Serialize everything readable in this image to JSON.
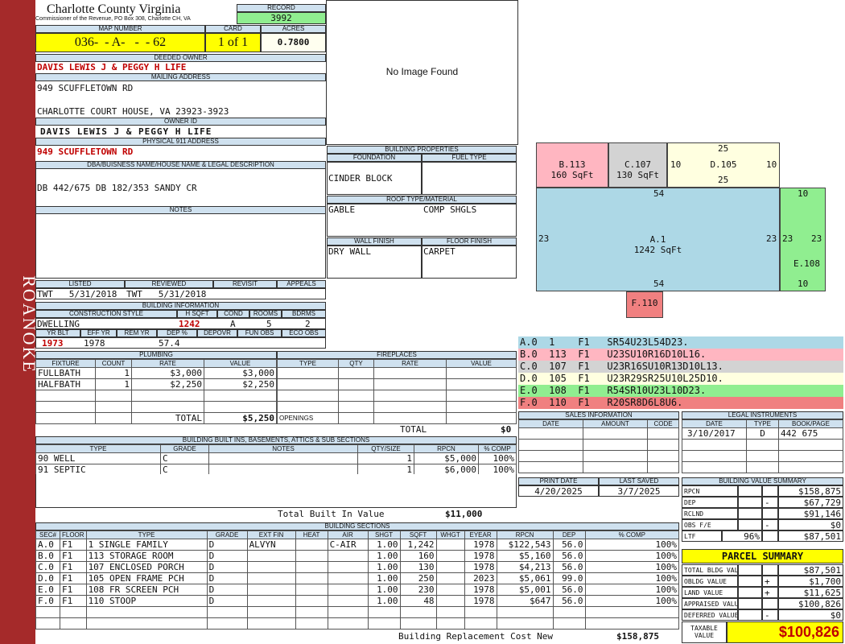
{
  "sidebar_label": "ROANOKE",
  "county": "Charlotte County Virginia",
  "commissioner": "Commissioner of the Revenue, PO Box 308, Charlotte CH, VA",
  "labels": {
    "record": "RECORD",
    "map_number": "MAP NUMBER",
    "card": "CARD",
    "acres": "ACRES",
    "deeded_owner": "DEEDED OWNER",
    "mailing_address": "MAILING ADDRESS",
    "owner_id": "OWNER ID",
    "physical_address": "PHYSICAL 911 ADDRESS",
    "dba": "DBA/BUISNESS NAME/HOUSE NAME & LEGAL DESCRIPTION",
    "notes": "NOTES",
    "listed": "LISTED",
    "reviewed": "REVIEWED",
    "revisit": "REVISIT",
    "appeals": "APPEALS",
    "building_information": "BUILDING INFORMATION",
    "construction_style": "CONSTRUCTION STYLE",
    "h_sqft": "H SQFT",
    "cond": "COND",
    "rooms": "ROOMS",
    "bdrms": "BDRMS",
    "yr_blt": "YR BLT",
    "eff_yr": "EFF YR",
    "rem_yr": "REM YR",
    "dep_pct": "DEP %",
    "depovr": "DEPOVR",
    "fun_obs": "FUN OBS",
    "eco_obs": "ECO OBS",
    "building_properties": "BUILDING PROPERTIES",
    "foundation": "FOUNDATION",
    "fuel_type": "FUEL TYPE",
    "roof": "ROOF TYPE/MATERIAL",
    "wall_finish": "WALL FINISH",
    "floor_finish": "FLOOR FINISH",
    "plumbing": "PLUMBING",
    "fireplaces": "FIREPLACES",
    "built_ins": "BUILDING BUILT INS, BASEMENTS, ATTICS & SUB SECTIONS",
    "building_sections": "BUILDING SECTIONS",
    "sales_information": "SALES INFORMATION",
    "legal_instruments": "LEGAL INSTRUMENTS",
    "print_date": "PRINT DATE",
    "last_saved": "LAST SAVED",
    "value_summary": "BUILDING VALUE SUMMARY",
    "parcel_summary": "PARCEL SUMMARY",
    "openings": "OPENINGS",
    "total": "TOTAL"
  },
  "record": "3992",
  "map_number": "036-  - A-   -  - 62",
  "card": "1 of 1",
  "acres": "0.7800",
  "deeded_owner": "DAVIS LEWIS J & PEGGY H LIFE",
  "mailing_line1": "949 SCUFFLETOWN RD",
  "mailing_line2": "CHARLOTTE COURT HOUSE, VA 23923-3923",
  "owner_id": "DAVIS LEWIS J & PEGGY H LIFE",
  "physical_address": "949 SCUFFLETOWN RD",
  "legal_description": "DB 442/675 DB 182/353 SANDY CR",
  "image_placeholder": "No Image Found",
  "listed": "TWT   5/31/2018",
  "reviewed": "TWT   5/31/2018",
  "building_info": {
    "style": "DWELLING",
    "hsqft": "1242",
    "cond": "A",
    "rooms": "5",
    "bdrms": "2",
    "yr_blt": "1973",
    "eff_yr": "1978",
    "rem_yr": "",
    "dep": "57.4"
  },
  "properties": {
    "foundation": "CINDER BLOCK",
    "fuel": "",
    "roof1": "GABLE",
    "roof2": "COMP SHGLS",
    "wall": "DRY WALL",
    "floor": "CARPET"
  },
  "plumbing": {
    "headers": [
      "FIXTURE",
      "COUNT",
      "RATE",
      "VALUE"
    ],
    "rows": [
      [
        "FULLBATH",
        "1",
        "$3,000",
        "$3,000"
      ],
      [
        "HALFBATH",
        "1",
        "$2,250",
        "$2,250"
      ]
    ],
    "total": "$5,250"
  },
  "fireplaces": {
    "headers": [
      "TYPE",
      "QTY",
      "RATE",
      "VALUE"
    ],
    "total": "$0"
  },
  "built_ins": {
    "headers": [
      "TYPE",
      "GRADE",
      "NOTES",
      "QTY/SIZE",
      "RPCN",
      "% COMP"
    ],
    "rows": [
      [
        "90 WELL",
        "C",
        "",
        "1",
        "$5,000",
        "100%"
      ],
      [
        "91 SEPTIC",
        "C",
        "",
        "1",
        "$6,000",
        "100%"
      ]
    ],
    "total_label": "Total Built In Value",
    "total": "$11,000"
  },
  "sections": {
    "headers": [
      "SEC#",
      "FLOOR",
      "TYPE",
      "GRADE",
      "EXT FIN",
      "HEAT",
      "AIR",
      "SHGT",
      "SQFT",
      "WHGT",
      "EYEAR",
      "RPCN",
      "DEP",
      "% COMP"
    ],
    "rows": [
      [
        "A.0",
        "F1",
        "1 SINGLE FAMILY",
        "D",
        "ALVYN",
        "",
        "C-AIR",
        "1.00",
        "1,242",
        "",
        "1978",
        "$122,543",
        "56.0",
        "100%"
      ],
      [
        "B.0",
        "F1",
        "113 STORAGE ROOM",
        "D",
        "",
        "",
        "",
        "1.00",
        "160",
        "",
        "1978",
        "$5,160",
        "56.0",
        "100%"
      ],
      [
        "C.0",
        "F1",
        "107 ENCLOSED PORCH",
        "D",
        "",
        "",
        "",
        "1.00",
        "130",
        "",
        "1978",
        "$4,213",
        "56.0",
        "100%"
      ],
      [
        "D.0",
        "F1",
        "105 OPEN FRAME PCH",
        "D",
        "",
        "",
        "",
        "1.00",
        "250",
        "",
        "2023",
        "$5,061",
        "99.0",
        "100%"
      ],
      [
        "E.0",
        "F1",
        "108 FR SCREEN PCH",
        "D",
        "",
        "",
        "",
        "1.00",
        "230",
        "",
        "1978",
        "$5,001",
        "56.0",
        "100%"
      ],
      [
        "F.0",
        "F1",
        "110 STOOP",
        "D",
        "",
        "",
        "",
        "1.00",
        "48",
        "",
        "1978",
        "$647",
        "56.0",
        "100%"
      ]
    ],
    "brcn_label": "Building Replacement Cost New",
    "brcn": "$158,875"
  },
  "sketch": {
    "b_label": "B.113",
    "b_area": "160 SqFt",
    "c_label": "C.107",
    "c_area": "130 SqFt",
    "d_label": "D.105",
    "a_label": "A.1",
    "a_area": "1242 SqFt",
    "e_label": "E.108",
    "f_label": "F.110",
    "dims": {
      "d_top": "25",
      "d_bottom": "25",
      "d_left": "10",
      "d_right": "10",
      "a_top": "54",
      "a_bottom": "54",
      "a_left": "23",
      "a_right": "23",
      "e_left": "23",
      "e_right": "23",
      "e_top": "10",
      "e_bottom": "10"
    }
  },
  "segments": [
    {
      "text": "A.0  1    F1   SR54U23L54D23.",
      "color": "#add8e6"
    },
    {
      "text": "B.0  113  F1   U23SU10R16D10L16.",
      "color": "#ffb6c1"
    },
    {
      "text": "C.0  107  F1   U23R16SU10R13D10L13.",
      "color": "#d3d3d3"
    },
    {
      "text": "D.0  105  F1   U23R29SR25U10L25D10.",
      "color": "#ffffe0"
    },
    {
      "text": "E.0  108  F1   R54SR10U23L10D23.",
      "color": "#90ee90"
    },
    {
      "text": "F.0  110  F1   R20SR8D6L8U6.",
      "color": "#f08080"
    }
  ],
  "sales": {
    "headers": [
      "DATE",
      "AMOUNT",
      "CODE"
    ]
  },
  "legal": {
    "headers": [
      "DATE",
      "TYPE",
      "BOOK/PAGE"
    ],
    "rows": [
      [
        "3/10/2017",
        "D",
        "442 675"
      ]
    ]
  },
  "print_date": "4/20/2025",
  "last_saved": "3/7/2025",
  "value_summary": [
    {
      "label": "RPCN",
      "sign": "",
      "value": "$158,875"
    },
    {
      "label": "DEP",
      "sign": "-",
      "value": "$67,729"
    },
    {
      "label": "RCLND",
      "sign": "",
      "value": "$91,146"
    },
    {
      "label": "OBS F/E",
      "sign": "-",
      "value": "$0"
    },
    {
      "label": "LTF",
      "pct": "96%",
      "sign": "",
      "value": "$87,501"
    }
  ],
  "parcel_summary": [
    {
      "label": "TOTAL BLDG VALUE",
      "sign": "",
      "value": "$87,501"
    },
    {
      "label": "OBLDG VALUE",
      "sign": "+",
      "value": "$1,700"
    },
    {
      "label": "LAND VALUE",
      "sign": "+",
      "value": "$11,625"
    },
    {
      "label": "APPRAISED VALUE",
      "sign": "",
      "value": "$100,826"
    },
    {
      "label": "DEFERRED VALUE",
      "sign": "-",
      "value": "$0"
    }
  ],
  "taxable_label": "TAXABLE VALUE",
  "taxable_value": "$100,826"
}
